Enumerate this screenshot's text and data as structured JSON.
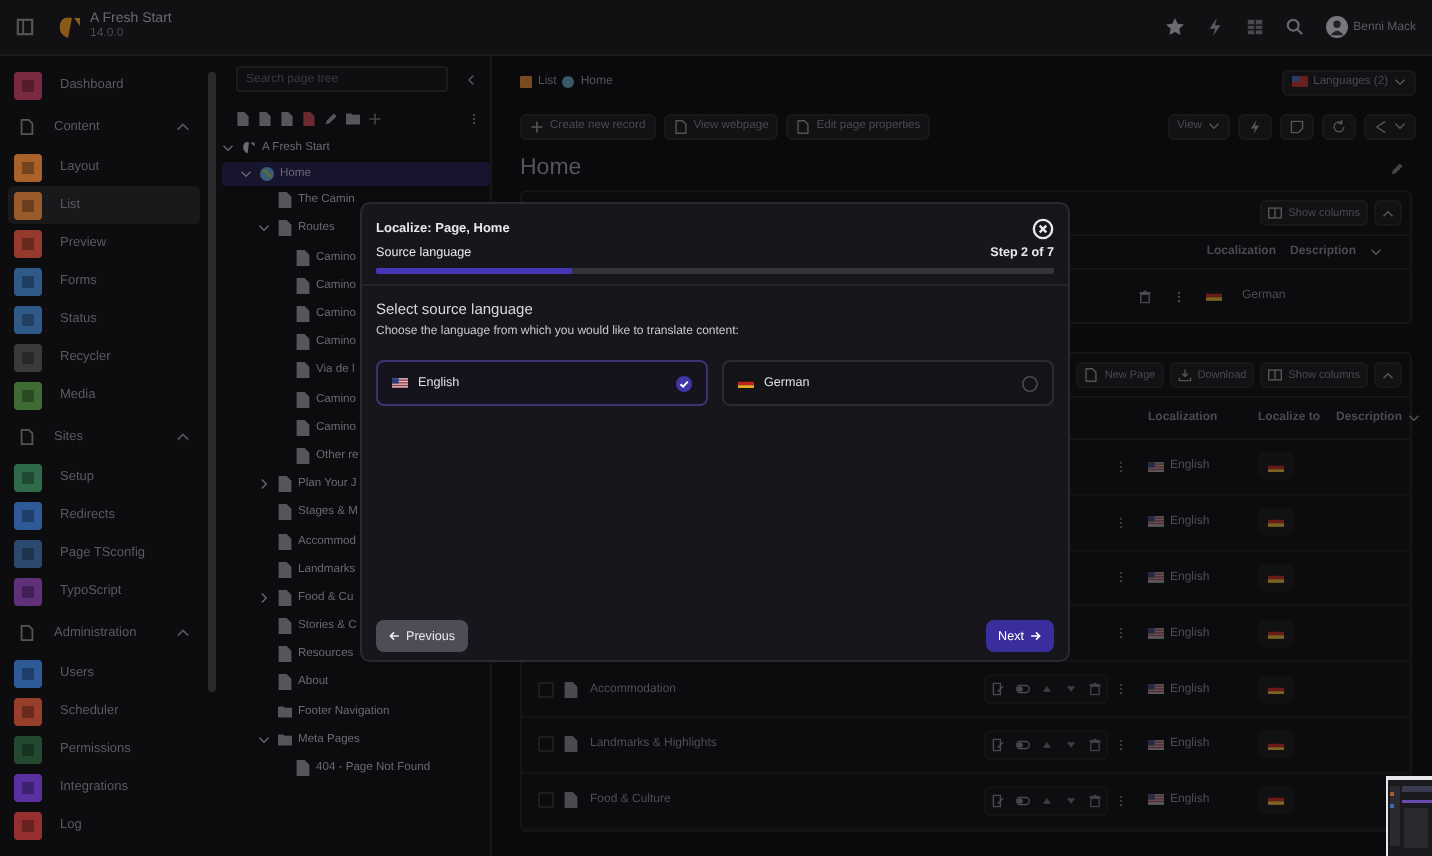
{
  "topbar": {
    "site_name": "A Fresh Start",
    "version": "14.0.0",
    "user": "Benni Mack"
  },
  "modules": [
    {
      "kind": "item",
      "label": "Dashboard",
      "color": "#7a2a40",
      "selected": false
    },
    {
      "kind": "group",
      "label": "Content",
      "expanded": true
    },
    {
      "kind": "item",
      "label": "Layout",
      "color": "#a8622a",
      "selected": false
    },
    {
      "kind": "item",
      "label": "List",
      "color": "#9a5a2a",
      "selected": true
    },
    {
      "kind": "item",
      "label": "Preview",
      "color": "#963a2c",
      "selected": false
    },
    {
      "kind": "item",
      "label": "Forms",
      "color": "#2f5a88",
      "selected": false
    },
    {
      "kind": "item",
      "label": "Status",
      "color": "#2f5a88",
      "selected": false
    },
    {
      "kind": "item",
      "label": "Recycler",
      "color": "#3a3a3c",
      "selected": false
    },
    {
      "kind": "item",
      "label": "Media",
      "color": "#3e6a34",
      "selected": false
    },
    {
      "kind": "group",
      "label": "Sites",
      "expanded": true
    },
    {
      "kind": "item",
      "label": "Setup",
      "color": "#2f6a4a",
      "selected": false
    },
    {
      "kind": "item",
      "label": "Redirects",
      "color": "#2f5a98",
      "selected": false
    },
    {
      "kind": "item",
      "label": "Page TSconfig",
      "color": "#2c4a70",
      "selected": false
    },
    {
      "kind": "item",
      "label": "TypoScript",
      "color": "#60307a",
      "selected": false
    },
    {
      "kind": "group",
      "label": "Administration",
      "expanded": true
    },
    {
      "kind": "item",
      "label": "Users",
      "color": "#2f5a98",
      "selected": false
    },
    {
      "kind": "item",
      "label": "Scheduler",
      "color": "#963e2a",
      "selected": false
    },
    {
      "kind": "item",
      "label": "Permissions",
      "color": "#234a30",
      "selected": false
    },
    {
      "kind": "item",
      "label": "Integrations",
      "color": "#5a30a0",
      "selected": false
    },
    {
      "kind": "item",
      "label": "Log",
      "color": "#963030",
      "selected": false
    }
  ],
  "page_tree": {
    "search": {
      "placeholder": "Search page tree"
    },
    "nodes": [
      {
        "kind": "site",
        "label": "A Fresh Start",
        "expanded": true,
        "selected": false,
        "children": [
          {
            "kind": "home",
            "label": "Home",
            "expanded": true,
            "selected": true,
            "children": [
              {
                "kind": "page",
                "label": "The Camin",
                "selected": false
              },
              {
                "kind": "page",
                "label": "Routes",
                "expanded": true,
                "selected": false,
                "children": [
                  {
                    "kind": "page",
                    "label": "Camino",
                    "selected": false
                  },
                  {
                    "kind": "page",
                    "label": "Camino",
                    "selected": false
                  },
                  {
                    "kind": "page",
                    "label": "Camino",
                    "selected": false
                  },
                  {
                    "kind": "page",
                    "label": "Camino",
                    "selected": false
                  },
                  {
                    "kind": "page",
                    "label": "Via de l",
                    "selected": false
                  },
                  {
                    "kind": "page",
                    "label": "Camino",
                    "selected": false
                  },
                  {
                    "kind": "page",
                    "label": "Camino",
                    "selected": false
                  },
                  {
                    "kind": "page",
                    "label": "Other re",
                    "selected": false
                  }
                ]
              },
              {
                "kind": "page",
                "label": "Plan Your J",
                "expanded": false,
                "selected": false
              },
              {
                "kind": "page",
                "label": "Stages & M",
                "selected": false
              },
              {
                "kind": "page",
                "label": "Accommod",
                "selected": false
              },
              {
                "kind": "page",
                "label": "Landmarks",
                "selected": false
              },
              {
                "kind": "page",
                "label": "Food & Cu",
                "expanded": false,
                "selected": false
              },
              {
                "kind": "page",
                "label": "Stories & C",
                "selected": false
              },
              {
                "kind": "page",
                "label": "Resources",
                "selected": false
              },
              {
                "kind": "page",
                "label": "About",
                "selected": false
              },
              {
                "kind": "folder",
                "label": "Footer Navigation",
                "selected": false
              },
              {
                "kind": "folder",
                "label": "Meta Pages",
                "expanded": true,
                "selected": false,
                "children": [
                  {
                    "kind": "page",
                    "label": "404 - Page Not Found",
                    "selected": false
                  }
                ]
              }
            ]
          }
        ]
      }
    ]
  },
  "main": {
    "breadcrumb": [
      "List",
      "Home"
    ],
    "languages_button": "Languages (2)",
    "actions": [
      "Create new record",
      "View webpage",
      "Edit page properties"
    ],
    "view_button": "View",
    "title": "Home",
    "translations_panel": {
      "show_columns": "Show columns",
      "columns": [
        "Localization",
        "Description"
      ],
      "rows": [
        {
          "localization": "German",
          "kind": "de"
        }
      ]
    },
    "pages_panel": {
      "actions": [
        "New Page",
        "Download",
        "Show columns"
      ],
      "columns": [
        "Localization",
        "Localize to",
        "Description"
      ],
      "rows": [
        {
          "localization": "English"
        },
        {
          "localization": "English"
        },
        {
          "localization": "English"
        },
        {
          "localization": "English"
        },
        {
          "title": "Accommodation",
          "checked": false,
          "localization": "English"
        },
        {
          "title": "Landmarks & Highlights",
          "checked": false,
          "localization": "English"
        },
        {
          "title": "Food & Culture",
          "checked": false,
          "localization": "English"
        }
      ]
    }
  },
  "modal": {
    "title": "Localize: Page, Home",
    "step_label": "Source language",
    "step": "Step 2 of 7",
    "level": 0.29,
    "heading": "Select source language",
    "description": "Choose the language from which you would like to translate content:",
    "options": [
      {
        "label": "English",
        "kind": "us",
        "selected": true
      },
      {
        "label": "German",
        "kind": "de",
        "selected": false
      }
    ],
    "previous": "Previous",
    "next": "Next"
  }
}
